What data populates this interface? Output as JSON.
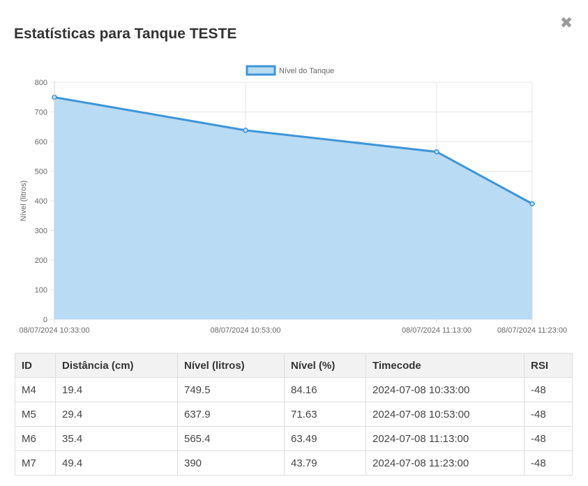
{
  "modal": {
    "title": "Estatísticas para Tanque TESTE",
    "close_icon": "close-icon"
  },
  "chart_data": {
    "type": "area",
    "title": "",
    "xlabel": "",
    "ylabel": "Nível (litros)",
    "ylim": [
      0,
      800
    ],
    "yticks": [
      0,
      100,
      200,
      300,
      400,
      500,
      600,
      700,
      800
    ],
    "x": [
      "08/07/2024 10:33:00",
      "08/07/2024 10:53:00",
      "08/07/2024 11:13:00",
      "08/07/2024 11:23:00"
    ],
    "x_minutes": [
      0,
      20,
      40,
      50
    ],
    "grid": true,
    "legend_position": "top",
    "series": [
      {
        "name": "Nível do Tanque",
        "values": [
          749.5,
          637.9,
          565.4,
          390
        ],
        "line_color": "#3e95d8",
        "fill_color": "#b9dbf3"
      }
    ]
  },
  "table": {
    "columns": [
      "ID",
      "Distância (cm)",
      "Nível (litros)",
      "Nível (%)",
      "Timecode",
      "RSI"
    ],
    "rows": [
      [
        "M4",
        "19.4",
        "749.5",
        "84.16",
        "2024-07-08 10:33:00",
        "-48"
      ],
      [
        "M5",
        "29.4",
        "637.9",
        "71.63",
        "2024-07-08 10:53:00",
        "-48"
      ],
      [
        "M6",
        "35.4",
        "565.4",
        "63.49",
        "2024-07-08 11:13:00",
        "-48"
      ],
      [
        "M7",
        "49.4",
        "390",
        "43.79",
        "2024-07-08 11:23:00",
        "-48"
      ]
    ]
  }
}
